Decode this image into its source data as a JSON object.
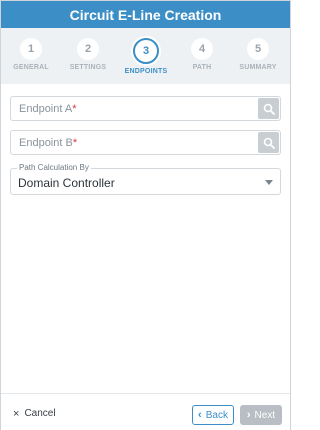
{
  "header": {
    "title": "Circuit E-Line Creation"
  },
  "steps": [
    {
      "number": "1",
      "label": "GENERAL"
    },
    {
      "number": "2",
      "label": "SETTINGS"
    },
    {
      "number": "3",
      "label": "ENDPOINTS",
      "active": true
    },
    {
      "number": "4",
      "label": "PATH"
    },
    {
      "number": "5",
      "label": "SUMMARY"
    }
  ],
  "form": {
    "endpoint_a": {
      "placeholder": "Endpoint A",
      "required_mark": "*"
    },
    "endpoint_b": {
      "placeholder": "Endpoint B",
      "required_mark": "*"
    },
    "path_calc": {
      "label": "Path Calculation By",
      "value": "Domain Controller"
    }
  },
  "footer": {
    "cancel_label": "Cancel",
    "cancel_icon": "×",
    "back_label": "Back",
    "back_icon": "‹",
    "next_label": "Next",
    "next_icon": "›"
  },
  "colors": {
    "accent": "#3c8fc6",
    "required": "#d9353b",
    "disabled": "#b8bec4"
  }
}
